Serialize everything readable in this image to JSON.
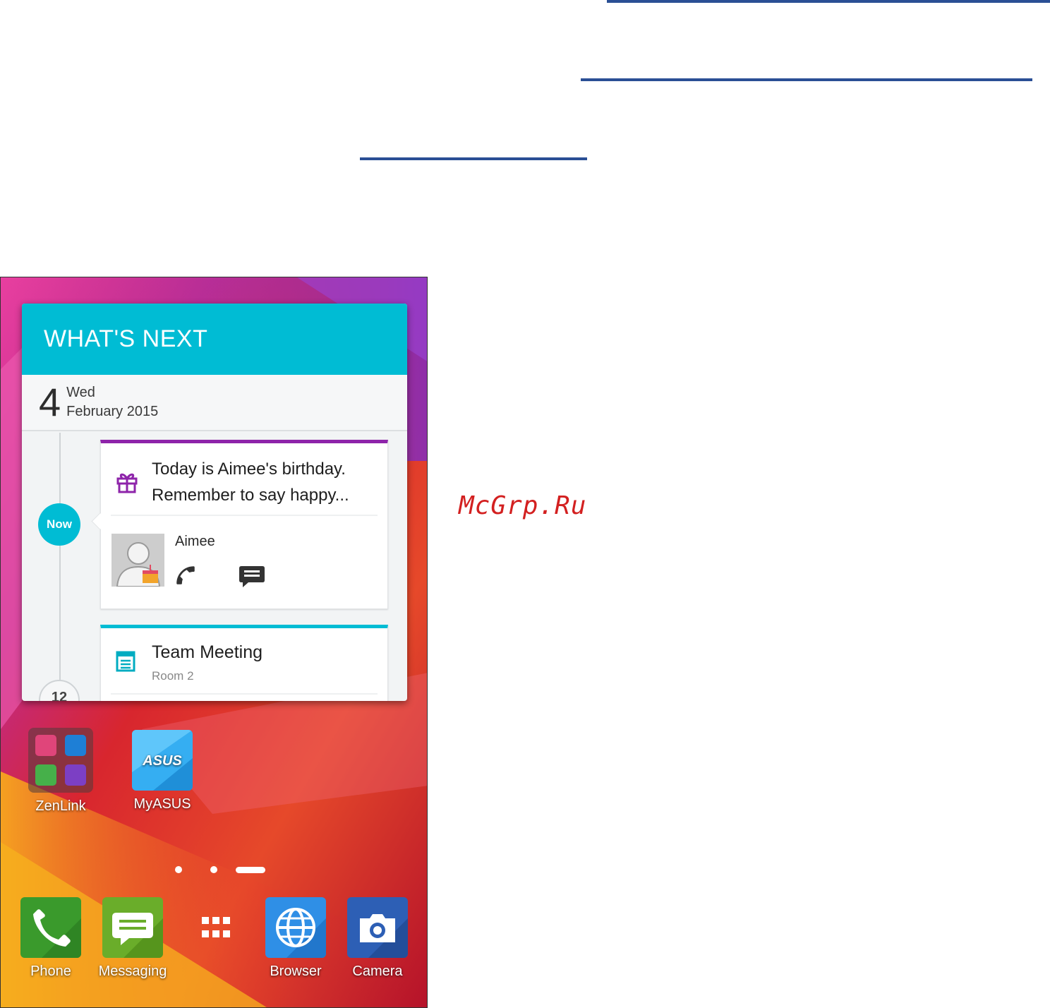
{
  "watermark": "McGrp.Ru",
  "widget": {
    "title": "WHAT'S NEXT",
    "date": {
      "day": "4",
      "weekday": "Wed",
      "month_year": "February 2015"
    },
    "now_badge": "Now",
    "next_badge": "12",
    "birthday_card": {
      "line1": "Today is Aimee's birthday.",
      "line2": "Remember to say happy...",
      "contact_name": "Aimee",
      "accent": "#8e24aa"
    },
    "meeting_card": {
      "title": "Team Meeting",
      "room": "Room 2",
      "accent": "#00bcd4"
    }
  },
  "home_apps": [
    {
      "label": "ZenLink",
      "icon": "folder-icon"
    },
    {
      "label": "MyASUS",
      "icon": "myasus-icon",
      "logo_text": "ASUS"
    }
  ],
  "page_indicator": {
    "pages": 3,
    "current": 3
  },
  "dock": [
    {
      "label": "Phone",
      "icon": "phone-icon",
      "color": "#3a9a2c"
    },
    {
      "label": "Messaging",
      "icon": "messaging-icon",
      "color": "#6aad2a"
    },
    {
      "label": "",
      "icon": "app-drawer-icon"
    },
    {
      "label": "Browser",
      "icon": "globe-icon",
      "color": "#2f8fe6"
    },
    {
      "label": "Camera",
      "icon": "camera-icon",
      "color": "#2d5fb5"
    }
  ]
}
